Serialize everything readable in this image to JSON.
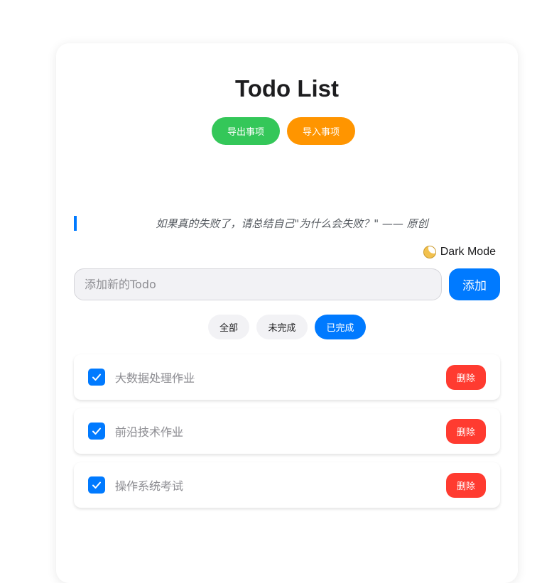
{
  "app": {
    "title": "Todo List"
  },
  "toolbar": {
    "export_label": "导出事项",
    "import_label": "导入事项"
  },
  "quote": {
    "text": "如果真的失败了，请总结自己\"为什么会失败？\" —— 原创"
  },
  "theme": {
    "toggle_label": "Dark Mode",
    "toggle_icon": "moon-icon"
  },
  "add": {
    "placeholder": "添加新的Todo",
    "value": "",
    "button_label": "添加"
  },
  "filters": [
    {
      "label": "全部",
      "active": false
    },
    {
      "label": "未完成",
      "active": false
    },
    {
      "label": "已完成",
      "active": true
    }
  ],
  "todos": [
    {
      "text": "大数据处理作业",
      "done": true,
      "delete_label": "删除"
    },
    {
      "text": "前沿技术作业",
      "done": true,
      "delete_label": "删除"
    },
    {
      "text": "操作系统考试",
      "done": true,
      "delete_label": "删除"
    }
  ],
  "colors": {
    "primary": "#007aff",
    "export": "#34c759",
    "import": "#ff9500",
    "danger": "#ff3b30"
  }
}
